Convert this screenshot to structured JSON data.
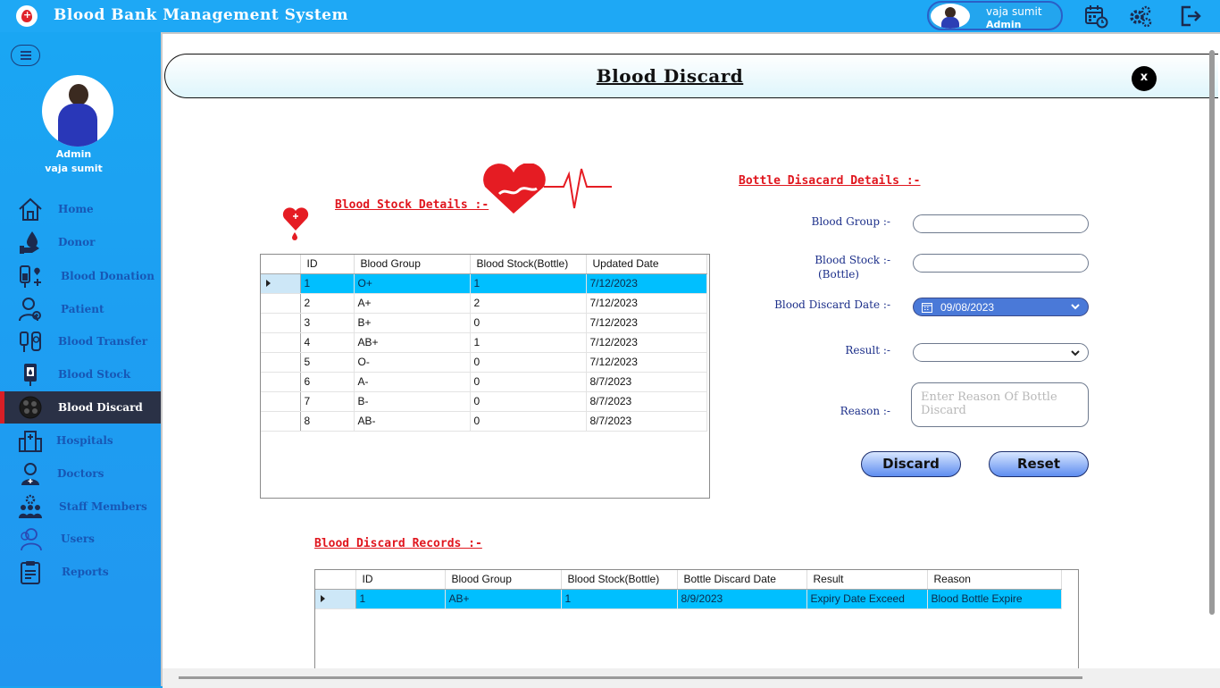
{
  "app": {
    "title": "Blood Bank Management System"
  },
  "header": {
    "user_name": "vaja sumit",
    "user_role": "Admin"
  },
  "sidebar": {
    "role": "Admin",
    "name": "vaja sumit",
    "items": [
      {
        "label": "Home",
        "icon": "home-icon"
      },
      {
        "label": "Donor",
        "icon": "donor-icon"
      },
      {
        "label": "Blood Donation",
        "icon": "blood-donation-icon"
      },
      {
        "label": "Patient",
        "icon": "patient-icon"
      },
      {
        "label": "Blood Transfer",
        "icon": "blood-transfer-icon"
      },
      {
        "label": "Blood Stock",
        "icon": "blood-stock-icon"
      },
      {
        "label": "Blood Discard",
        "icon": "blood-discard-icon",
        "active": true
      },
      {
        "label": "Hospitals",
        "icon": "hospital-icon"
      },
      {
        "label": "Doctors",
        "icon": "doctor-icon"
      },
      {
        "label": "Staff Members",
        "icon": "staff-icon"
      },
      {
        "label": "Users",
        "icon": "users-icon"
      },
      {
        "label": "Reports",
        "icon": "reports-icon"
      }
    ]
  },
  "page": {
    "title": "Blood Discard",
    "close_label": "x"
  },
  "stock": {
    "heading": "Blood Stock Details :-",
    "columns": [
      "ID",
      "Blood Group",
      "Blood Stock(Bottle)",
      "Updated Date"
    ],
    "rows": [
      [
        "1",
        "O+",
        "1",
        "7/12/2023"
      ],
      [
        "2",
        "A+",
        "2",
        "7/12/2023"
      ],
      [
        "3",
        "B+",
        "0",
        "7/12/2023"
      ],
      [
        "4",
        "AB+",
        "1",
        "7/12/2023"
      ],
      [
        "5",
        "O-",
        "0",
        "7/12/2023"
      ],
      [
        "6",
        "A-",
        "0",
        "8/7/2023"
      ],
      [
        "7",
        "B-",
        "0",
        "8/7/2023"
      ],
      [
        "8",
        "AB-",
        "0",
        "8/7/2023"
      ]
    ],
    "selected_row": 0
  },
  "form": {
    "heading": "Bottle Disacard Details :-",
    "blood_group_label": "Blood Group :-",
    "blood_group_value": "",
    "blood_stock_label_1": "Blood Stock :-",
    "blood_stock_label_2": "(Bottle)",
    "blood_stock_value": "",
    "discard_date_label": "Blood Discard Date :-",
    "discard_date_value": "09/08/2023",
    "result_label": "Result :-",
    "result_value": "",
    "reason_label": "Reason :-",
    "reason_placeholder": "Enter Reason Of Bottle Discard",
    "discard_button": "Discard",
    "reset_button": "Reset"
  },
  "records": {
    "heading": "Blood Discard Records :-",
    "columns": [
      "ID",
      "Blood Group",
      "Blood Stock(Bottle)",
      "Bottle Discard Date",
      "Result",
      "Reason"
    ],
    "rows": [
      [
        "1",
        "AB+",
        "1",
        "8/9/2023",
        "Expiry Date Exceed",
        "Blood Bottle Expire"
      ]
    ],
    "selected_row": 0
  },
  "colors": {
    "accent": "#1ea8f5",
    "selected_row": "#00bfff",
    "heading_red": "#e0161e",
    "active_nav": "#2a3146"
  }
}
